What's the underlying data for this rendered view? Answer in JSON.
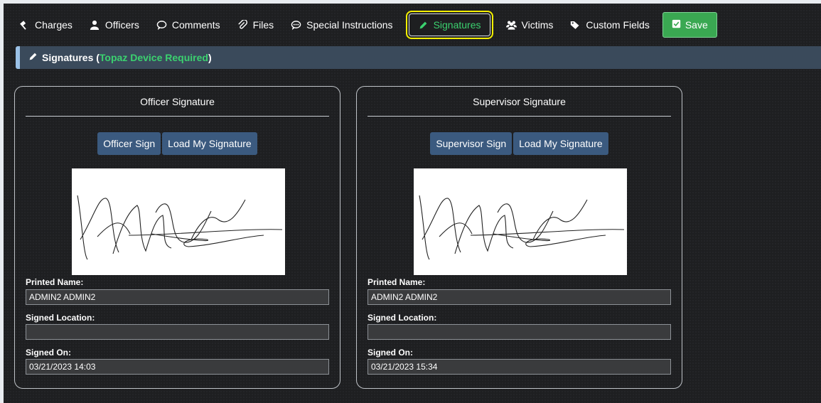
{
  "nav": {
    "items": [
      {
        "label": "Charges",
        "icon": "gavel-icon"
      },
      {
        "label": "Officers",
        "icon": "user-icon"
      },
      {
        "label": "Comments",
        "icon": "comment-icon"
      },
      {
        "label": "Files",
        "icon": "paperclip-icon"
      },
      {
        "label": "Special Instructions",
        "icon": "chat-bubbles-icon"
      },
      {
        "label": "Signatures",
        "icon": "pencil-icon",
        "active": true
      },
      {
        "label": "Victims",
        "icon": "users-icon"
      },
      {
        "label": "Custom Fields",
        "icon": "tags-icon"
      }
    ],
    "save_label": "Save"
  },
  "panel": {
    "title": "Signatures",
    "paren_open": "(",
    "requirement": "Topaz Device Required",
    "paren_close": ")"
  },
  "officer": {
    "title": "Officer Signature",
    "sign_button": "Officer Sign",
    "load_button": "Load My Signature",
    "printed_name_label": "Printed Name:",
    "printed_name": "ADMIN2 ADMIN2",
    "signed_location_label": "Signed Location:",
    "signed_location": "",
    "signed_on_label": "Signed On:",
    "signed_on": "03/21/2023 14:03"
  },
  "supervisor": {
    "title": "Supervisor Signature",
    "sign_button": "Supervisor Sign",
    "load_button": "Load My Signature",
    "printed_name_label": "Printed Name:",
    "printed_name": "ADMIN2 ADMIN2",
    "signed_location_label": "Signed Location:",
    "signed_location": "",
    "signed_on_label": "Signed On:",
    "signed_on": "03/21/2023 15:34"
  },
  "colors": {
    "accent_green": "#3bd16f",
    "save_green": "#3aa852",
    "button_blue": "#3b5a7f",
    "highlight_yellow": "#f4f000"
  }
}
